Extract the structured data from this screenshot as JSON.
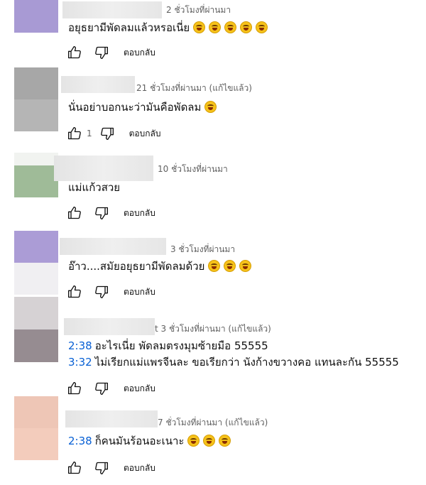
{
  "ui": {
    "reply_label": "ตอบกลับ"
  },
  "colors": {
    "link": "#065fd4",
    "meta": "#606060"
  },
  "comments": [
    {
      "time": "2 ชั่วโมงที่ผ่านมา",
      "lines": [
        {
          "text": "อยุธยามีพัดลมแล้วหรอเนี่ย",
          "emoji": 5
        }
      ],
      "likes": ""
    },
    {
      "time": "21 ชั่วโมงที่ผ่านมา (แก้ไขแล้ว)",
      "lines": [
        {
          "text": "นั่นอย่าบอกนะว่ามันคือพัดลม",
          "emoji": 1
        }
      ],
      "likes": "1"
    },
    {
      "time": "10 ชั่วโมงที่ผ่านมา",
      "lines": [
        {
          "text": "แม่แก้วสวย",
          "emoji": 0
        }
      ],
      "likes": ""
    },
    {
      "time": "3 ชั่วโมงที่ผ่านมา",
      "lines": [
        {
          "text": "อ๊าว....สมัยอยุธยามีพัดลมด้วย",
          "emoji": 3
        }
      ],
      "likes": ""
    },
    {
      "time": "t 3 ชั่วโมงที่ผ่านมา (แก้ไขแล้ว)",
      "lines": [
        {
          "timestamp": "2:38",
          "text": "อะไรเนี่ย พัดลมตรงมุมซ้ายมือ 55555",
          "emoji": 0
        },
        {
          "timestamp": "3:32",
          "text": "ไม่เรียกแม่แพรจีนละ ขอเรียกว่า นังก้างขวางคอ แทนละกัน 55555",
          "emoji": 0
        }
      ],
      "likes": ""
    },
    {
      "time": "7 ชั่วโมงที่ผ่านมา (แก้ไขแล้ว)",
      "lines": [
        {
          "timestamp": "2:38",
          "text": "ก็คนมันร้อนอะเนาะ",
          "emoji": 3
        }
      ],
      "likes": ""
    }
  ]
}
